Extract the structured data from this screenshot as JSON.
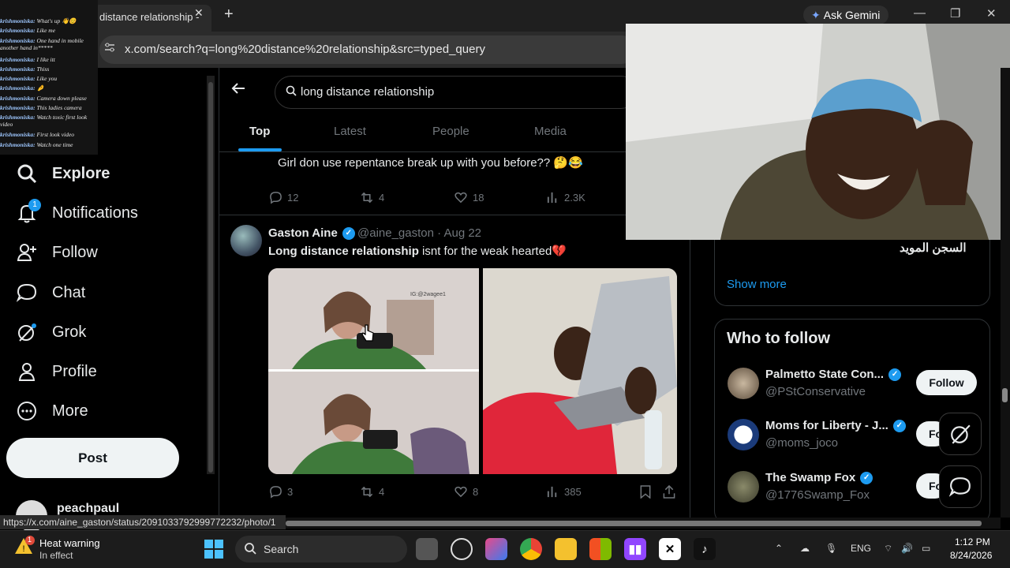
{
  "browser": {
    "tab_title": "distance relationship - ",
    "tab_close": "✕",
    "new_tab": "+",
    "url": "x.com/search?q=long%20distance%20relationship&src=typed_query",
    "gemini_label": "Ask Gemini",
    "status_url": "https://x.com/aine_gaston/status/2091033792999772232/photo/1"
  },
  "chat_overlay": [
    {
      "user": "krishmoniska:",
      "msg": "What's up 👋😊"
    },
    {
      "user": "krishmoniska:",
      "msg": "Like me"
    },
    {
      "user": "krishmoniska:",
      "msg": "One hand in mobile another hand in*****"
    },
    {
      "user": "krishmoniska:",
      "msg": "I like itt"
    },
    {
      "user": "krishmoniska:",
      "msg": "Thiss"
    },
    {
      "user": "krishmoniska:",
      "msg": "Like you"
    },
    {
      "user": "krishmoniska:",
      "msg": "🤌"
    },
    {
      "user": "krishmoniska:",
      "msg": "Camera down please"
    },
    {
      "user": "krishmoniska:",
      "msg": "This ladies camera"
    },
    {
      "user": "krishmoniska:",
      "msg": "Watch toxic first look video"
    },
    {
      "user": "krishmoniska:",
      "msg": "First look video"
    },
    {
      "user": "krishmoniska:",
      "msg": "Watch one time"
    }
  ],
  "sidebar": {
    "items": [
      {
        "label": "Explore"
      },
      {
        "label": "Notifications",
        "badge": "1"
      },
      {
        "label": "Follow"
      },
      {
        "label": "Chat"
      },
      {
        "label": "Grok"
      },
      {
        "label": "Profile"
      },
      {
        "label": "More"
      }
    ],
    "post_label": "Post",
    "profile_name": "peachpaul"
  },
  "search": {
    "query": "long distance relationship",
    "tabs": [
      "Top",
      "Latest",
      "People",
      "Media"
    ]
  },
  "tweet1": {
    "text": "Girl don use repentance break up with you before?? 🤔😂",
    "replies": "12",
    "retweets": "4",
    "likes": "18",
    "views": "2.3K"
  },
  "tweet2": {
    "name": "Gaston Aine",
    "handle": "@aine_gaston",
    "date": "· Aug 22",
    "text_bold": "Long distance relationship",
    "text_rest": " isnt for the weak hearted💔",
    "img_watermark": "IG:@2wagee1",
    "replies": "3",
    "retweets": "4",
    "likes": "8",
    "views": "385"
  },
  "right": {
    "arabic_text": "السجن المويد",
    "show_more": "Show more",
    "who_to_follow": "Who to follow",
    "follows": [
      {
        "name": "Palmetto State Con...",
        "handle": "@PStConservative",
        "button": "Follow"
      },
      {
        "name": "Moms for Liberty - J...",
        "handle": "@moms_joco",
        "button": "Fo"
      },
      {
        "name": "The Swamp Fox",
        "handle": "@1776Swamp_Fox",
        "button": "Fo"
      }
    ]
  },
  "taskbar": {
    "weather_title": "Heat warning",
    "weather_sub": "In effect",
    "weather_badge": "1",
    "search_label": "Search",
    "lang": "ENG",
    "time": "1:12 PM",
    "date": "8/24/2026"
  },
  "colors": {
    "accent": "#1d9bf0",
    "bg": "#000000",
    "muted": "#71767b"
  }
}
